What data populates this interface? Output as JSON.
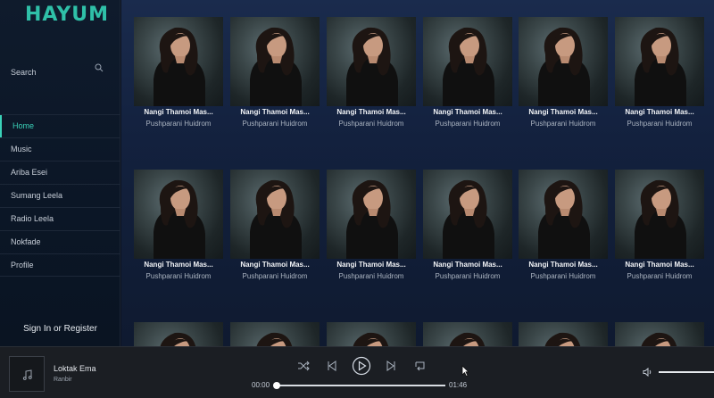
{
  "app": {
    "logo": "HAYUM"
  },
  "search": {
    "label": "Search",
    "icon": "search-icon"
  },
  "nav": {
    "items": [
      {
        "label": "Home",
        "active": true
      },
      {
        "label": "Music",
        "active": false
      },
      {
        "label": "Ariba Esei",
        "active": false
      },
      {
        "label": "Sumang Leela",
        "active": false
      },
      {
        "label": "Radio Leela",
        "active": false
      },
      {
        "label": "Nokfade",
        "active": false
      },
      {
        "label": "Profile",
        "active": false
      }
    ]
  },
  "auth": {
    "label": "Sign In or Register"
  },
  "grid": {
    "cards": [
      {
        "title": "Nangi Thamoi Mas...",
        "artist": "Pushparani Huidrom"
      },
      {
        "title": "Nangi Thamoi Mas...",
        "artist": "Pushparani Huidrom"
      },
      {
        "title": "Nangi Thamoi Mas...",
        "artist": "Pushparani Huidrom"
      },
      {
        "title": "Nangi Thamoi Mas...",
        "artist": "Pushparani Huidrom"
      },
      {
        "title": "Nangi Thamoi Mas...",
        "artist": "Pushparani Huidrom"
      },
      {
        "title": "Nangi Thamoi Mas...",
        "artist": "Pushparani Huidrom"
      },
      {
        "title": "Nangi Thamoi Mas...",
        "artist": "Pushparani Huidrom"
      },
      {
        "title": "Nangi Thamoi Mas...",
        "artist": "Pushparani Huidrom"
      },
      {
        "title": "Nangi Thamoi Mas...",
        "artist": "Pushparani Huidrom"
      },
      {
        "title": "Nangi Thamoi Mas...",
        "artist": "Pushparani Huidrom"
      },
      {
        "title": "Nangi Thamoi Mas...",
        "artist": "Pushparani Huidrom"
      },
      {
        "title": "Nangi Thamoi Mas...",
        "artist": "Pushparani Huidrom"
      },
      {
        "title": "",
        "artist": ""
      },
      {
        "title": "",
        "artist": ""
      },
      {
        "title": "",
        "artist": ""
      },
      {
        "title": "",
        "artist": ""
      },
      {
        "title": "",
        "artist": ""
      },
      {
        "title": "",
        "artist": ""
      }
    ]
  },
  "player": {
    "track_title": "Loktak Ema",
    "track_artist": "Ranbir",
    "elapsed": "00:00",
    "duration": "01:46",
    "progress": 0,
    "volume": 1.0,
    "icons": [
      "music-note-icon",
      "shuffle-icon",
      "previous-icon",
      "play-icon",
      "next-icon",
      "repeat-icon",
      "volume-icon"
    ]
  },
  "colors": {
    "accent": "#2fc0a8",
    "sidebar": "#0f1b2c",
    "content": "#1a2b4d",
    "player": "#1b1e23"
  }
}
